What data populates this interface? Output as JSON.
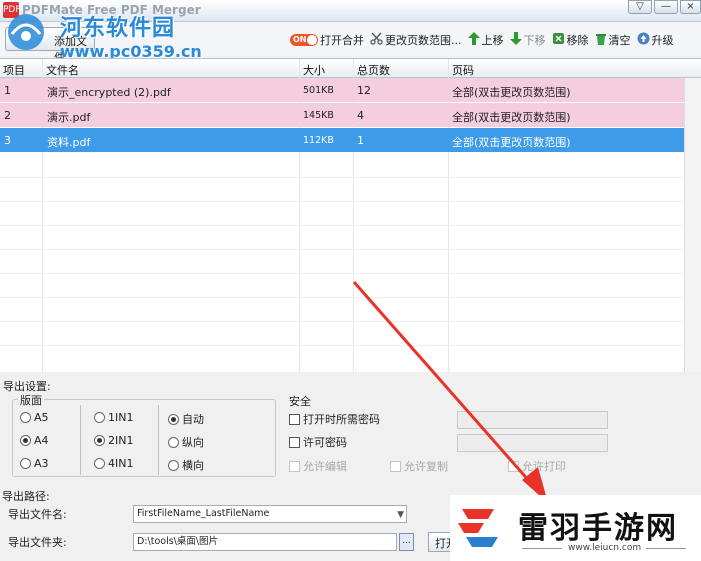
{
  "window": {
    "title": "PDFMate Free PDF Merger",
    "controls": [
      "▽",
      "—"
    ]
  },
  "watermark": {
    "site_name": "河东软件园",
    "url": "www.pc0359.cn"
  },
  "toolbar": {
    "add_file": "添加文件",
    "items": [
      {
        "id": "open-merge",
        "icon": "toggle-on-icon",
        "icon_text": "ON",
        "label": "打开合并",
        "disabled": false
      },
      {
        "id": "change-range",
        "icon": "scissors-icon",
        "label": "更改页数范围...",
        "disabled": false
      },
      {
        "id": "move-up",
        "icon": "arrow-up-icon",
        "label": "上移",
        "disabled": false
      },
      {
        "id": "move-down",
        "icon": "arrow-down-icon",
        "label": "下移",
        "disabled": true
      },
      {
        "id": "remove",
        "icon": "remove-icon",
        "label": "移除",
        "disabled": false
      },
      {
        "id": "clear",
        "icon": "trash-icon",
        "label": "清空",
        "disabled": false
      },
      {
        "id": "upgrade",
        "icon": "upgrade-icon",
        "label": "升级",
        "disabled": false
      }
    ]
  },
  "file_table": {
    "columns": [
      "项目",
      "文件名",
      "大小",
      "总页数",
      "页码"
    ],
    "rows": [
      {
        "index": "1",
        "name": "演示_encrypted (2).pdf",
        "size": "501KB",
        "pages": "12",
        "range": "全部(双击更改页数范围)",
        "state": "pink"
      },
      {
        "index": "2",
        "name": "演示.pdf",
        "size": "145KB",
        "pages": "4",
        "range": "全部(双击更改页数范围)",
        "state": "pink"
      },
      {
        "index": "3",
        "name": "资料.pdf",
        "size": "112KB",
        "pages": "1",
        "range": "全部(双击更改页数范围)",
        "state": "selected"
      }
    ]
  },
  "output_settings": {
    "heading": "导出设置:",
    "layout": {
      "label": "版面",
      "sizes": [
        {
          "label": "A5",
          "checked": false
        },
        {
          "label": "A4",
          "checked": true
        },
        {
          "label": "A3",
          "checked": false
        }
      ],
      "nup": [
        {
          "label": "1IN1",
          "checked": false
        },
        {
          "label": "2IN1",
          "checked": true
        },
        {
          "label": "4IN1",
          "checked": false
        }
      ],
      "orientation": [
        {
          "label": "自动",
          "checked": true
        },
        {
          "label": "纵向",
          "checked": false
        },
        {
          "label": "横向",
          "checked": false
        }
      ]
    },
    "security": {
      "label": "安全",
      "open_password": "打开时所需密码",
      "permission_password": "许可密码",
      "allow_edit": "允许编辑",
      "allow_copy": "允许复制",
      "allow_print": "允许打印"
    }
  },
  "output_path": {
    "heading": "导出路径:",
    "filename_label": "导出文件名:",
    "filename_value": "FirstFileName_LastFileName",
    "folder_label": "导出文件夹:",
    "folder_value": "D:\\tools\\桌面\\图片",
    "browse": "...",
    "open_button": "打开"
  },
  "ad_watermark": {
    "title": "雷羽手游网",
    "url": "www.leiucn.com"
  },
  "colors": {
    "pink_row": "#f4cedd",
    "selected_row": "#3d9bea",
    "arrow": "#e8322a"
  }
}
